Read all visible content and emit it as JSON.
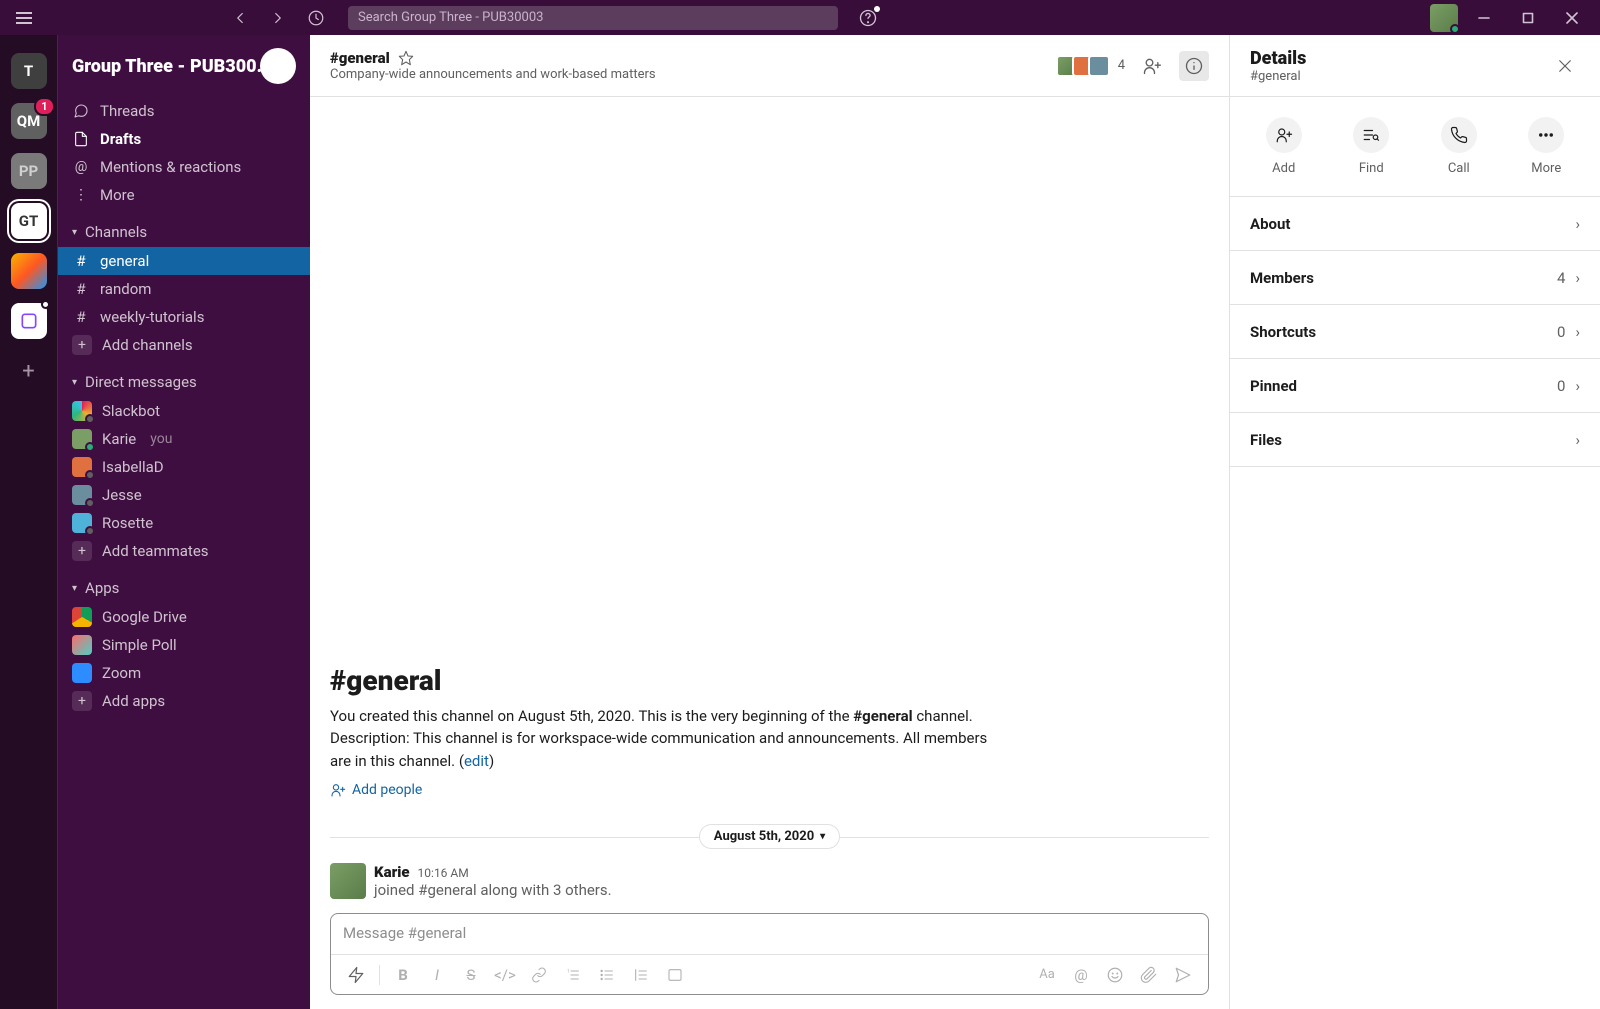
{
  "titlebar": {
    "search_placeholder": "Search Group Three - PUB30003"
  },
  "rail": {
    "workspaces": [
      {
        "id": "t",
        "initials": "T",
        "badge": ""
      },
      {
        "id": "qm",
        "initials": "QM",
        "badge": "1"
      },
      {
        "id": "pp",
        "initials": "PP",
        "badge": ""
      },
      {
        "id": "gt",
        "initials": "GT",
        "badge": ""
      }
    ]
  },
  "sidebar": {
    "workspace_name": "Group Three - PUB300...",
    "nav": {
      "threads": "Threads",
      "drafts": "Drafts",
      "mentions": "Mentions & reactions",
      "more": "More"
    },
    "channels_label": "Channels",
    "channels": [
      {
        "name": "general",
        "active": true
      },
      {
        "name": "random",
        "active": false
      },
      {
        "name": "weekly-tutorials",
        "active": false
      }
    ],
    "add_channels": "Add channels",
    "dms_label": "Direct messages",
    "dms": [
      {
        "name": "Slackbot",
        "you": false,
        "color": "#e01e5a,#ecb22e,#2eb67d,#36c5f0"
      },
      {
        "name": "Karie",
        "you": true,
        "color": "#7b9e66"
      },
      {
        "name": "IsabellaD",
        "you": false,
        "color": "#e07040"
      },
      {
        "name": "Jesse",
        "you": false,
        "color": "#6b8e9e"
      },
      {
        "name": "Rosette",
        "you": false,
        "color": "#4fb3d9"
      }
    ],
    "you_label": "you",
    "add_teammates": "Add teammates",
    "apps_label": "Apps",
    "apps": [
      {
        "name": "Google Drive"
      },
      {
        "name": "Simple Poll"
      },
      {
        "name": "Zoom"
      }
    ],
    "add_apps": "Add apps"
  },
  "channel": {
    "name": "#general",
    "topic": "Company-wide announcements and work-based matters",
    "member_count": "4",
    "intro_heading": "#general",
    "intro_text_1": "You created this channel on August 5th, 2020. This is the very beginning of the ",
    "intro_bold": "#general",
    "intro_text_2": " channel. Description: This channel is for workspace-wide communication and announcements. All members are in this channel. (",
    "intro_edit": "edit",
    "intro_text_3": ")",
    "add_people": "Add people",
    "date_divider": "August 5th, 2020",
    "message": {
      "author": "Karie",
      "time": "10:16 AM",
      "text": "joined #general along with 3 others."
    },
    "composer_placeholder": "Message #general"
  },
  "details": {
    "title": "Details",
    "subtitle": "#general",
    "actions": {
      "add": "Add",
      "find": "Find",
      "call": "Call",
      "more": "More"
    },
    "sections": {
      "about": "About",
      "members": "Members",
      "members_count": "4",
      "shortcuts": "Shortcuts",
      "shortcuts_count": "0",
      "pinned": "Pinned",
      "pinned_count": "0",
      "files": "Files"
    }
  }
}
